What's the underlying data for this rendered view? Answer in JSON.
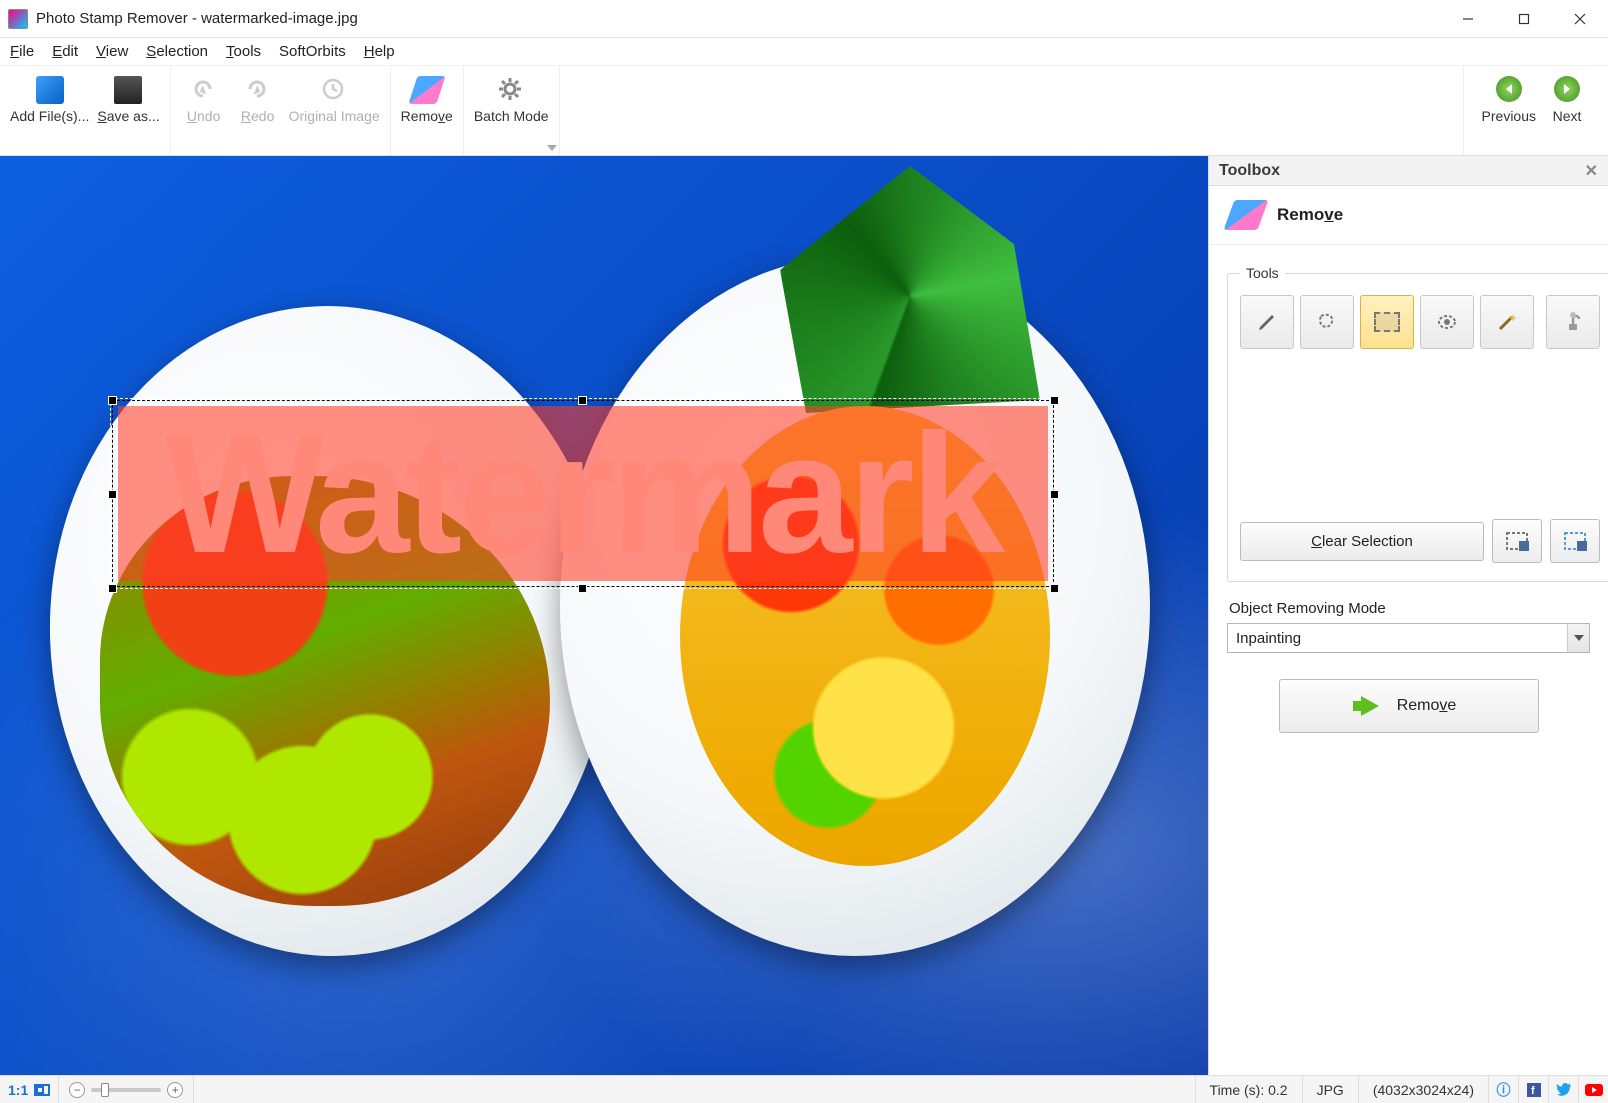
{
  "title": "Photo Stamp Remover - watermarked-image.jpg",
  "menu": {
    "file": "File",
    "edit": "Edit",
    "view": "View",
    "selection": "Selection",
    "tools": "Tools",
    "softorbits": "SoftOrbits",
    "help": "Help"
  },
  "toolbar": {
    "add": "Add File(s)...",
    "save": "Save as...",
    "undo": "Undo",
    "redo": "Redo",
    "orig": "Original Image",
    "remove": "Remove",
    "batch": "Batch Mode",
    "prev": "Previous",
    "next": "Next"
  },
  "toolbox": {
    "title": "Toolbox",
    "section": "Remove",
    "tools_legend": "Tools",
    "clear": "Clear Selection",
    "mode_label": "Object Removing Mode",
    "mode_value": "Inpainting",
    "remove_btn": "Remove"
  },
  "watermark": "Watermark",
  "status": {
    "ratio": "1:1",
    "time": "Time (s): 0.2",
    "format": "JPG",
    "dims": "(4032x3024x24)"
  }
}
